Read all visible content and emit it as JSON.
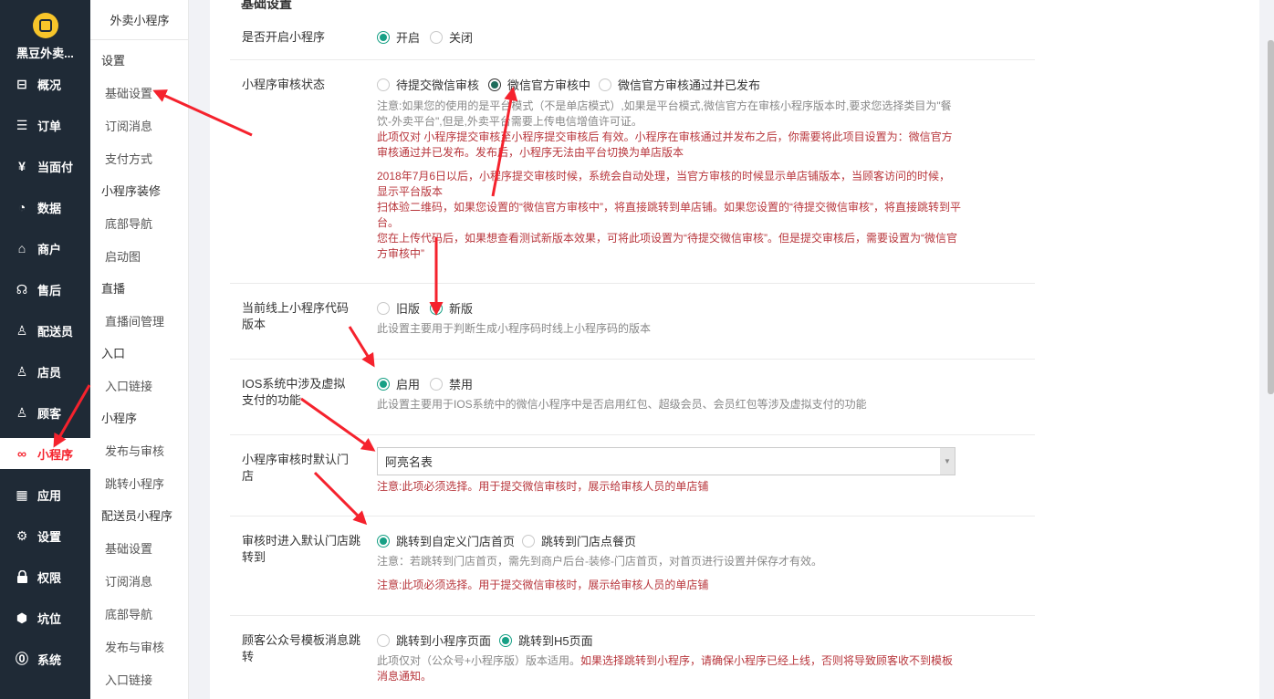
{
  "sidebar": {
    "brand": "黑豆外卖...",
    "items": [
      {
        "label": "概况",
        "icon": "overview-icon",
        "glyph": "⊟"
      },
      {
        "label": "订单",
        "icon": "order-icon",
        "glyph": "☰"
      },
      {
        "label": "当面付",
        "icon": "yen-icon",
        "glyph": "¥"
      },
      {
        "label": "数据",
        "icon": "chart-icon",
        "glyph": "◔"
      },
      {
        "label": "商户",
        "icon": "shop-icon",
        "glyph": "⌂"
      },
      {
        "label": "售后",
        "icon": "service-icon",
        "glyph": "☊"
      },
      {
        "label": "配送员",
        "icon": "courier-icon",
        "glyph": "♙"
      },
      {
        "label": "店员",
        "icon": "clerk-icon",
        "glyph": "♙"
      },
      {
        "label": "顾客",
        "icon": "customer-icon",
        "glyph": "♙"
      },
      {
        "label": "小程序",
        "icon": "miniprogram-icon",
        "glyph": "∞"
      },
      {
        "label": "应用",
        "icon": "apps-icon",
        "glyph": "▦"
      },
      {
        "label": "设置",
        "icon": "gear-icon",
        "glyph": "⚙"
      },
      {
        "label": "权限",
        "icon": "lock-icon",
        "glyph": "🔒"
      },
      {
        "label": "坑位",
        "icon": "cube-icon",
        "glyph": "⬢"
      },
      {
        "label": "系统",
        "icon": "system-icon",
        "glyph": "⓪"
      }
    ]
  },
  "subnav": {
    "title": "外卖小程序",
    "entries": [
      {
        "type": "group",
        "label": "设置"
      },
      {
        "type": "item",
        "label": "基础设置"
      },
      {
        "type": "item",
        "label": "订阅消息"
      },
      {
        "type": "item",
        "label": "支付方式"
      },
      {
        "type": "group",
        "label": "小程序装修"
      },
      {
        "type": "item",
        "label": "底部导航"
      },
      {
        "type": "item",
        "label": "启动图"
      },
      {
        "type": "group",
        "label": "直播"
      },
      {
        "type": "item",
        "label": "直播间管理"
      },
      {
        "type": "group",
        "label": "入口"
      },
      {
        "type": "item",
        "label": "入口链接"
      },
      {
        "type": "group",
        "label": "小程序"
      },
      {
        "type": "item",
        "label": "发布与审核"
      },
      {
        "type": "item",
        "label": "跳转小程序"
      },
      {
        "type": "group",
        "label": "配送员小程序"
      },
      {
        "type": "item",
        "label": "基础设置"
      },
      {
        "type": "item",
        "label": "订阅消息"
      },
      {
        "type": "item",
        "label": "底部导航"
      },
      {
        "type": "item",
        "label": "发布与审核"
      },
      {
        "type": "item",
        "label": "入口链接"
      }
    ]
  },
  "main": {
    "section_title": "基础设置",
    "enable": {
      "label": "是否开启小程序",
      "options": [
        "开启",
        "关闭"
      ]
    },
    "review_status": {
      "label": "小程序审核状态",
      "options": [
        "待提交微信审核",
        "微信官方审核中",
        "微信官方审核通过并已发布"
      ],
      "note_gray": "注意:如果您的使用的是平台模式（不是单店模式）,如果是平台模式,微信官方在审核小程序版本时,要求您选择类目为\"餐饮-外卖平台\",但是,外卖平台需要上传电信增值许可证。",
      "note_red_1": "此项仅对 小程序提交审核至小程序提交审核后 有效。小程序在审核通过并发布之后，你需要将此项目设置为：微信官方审核通过并已发布。发布后，小程序无法由平台切换为单店版本",
      "note_red_2": "2018年7月6日以后，小程序提交审核时候，系统会自动处理，当官方审核的时候显示单店铺版本，当顾客访问的时候，显示平台版本",
      "note_red_3": "扫体验二维码，如果您设置的“微信官方审核中”，将直接跳转到单店铺。如果您设置的“待提交微信审核”，将直接跳转到平台。",
      "note_red_4": "您在上传代码后，如果想查看测试新版本效果，可将此项设置为“待提交微信审核”。但是提交审核后，需要设置为“微信官方审核中”"
    },
    "code_version": {
      "label": "当前线上小程序代码版本",
      "options": [
        "旧版",
        "新版"
      ],
      "note": "此设置主要用于判断生成小程序码时线上小程序码的版本"
    },
    "ios_virtual": {
      "label": "IOS系统中涉及虚拟支付的功能",
      "options": [
        "启用",
        "禁用"
      ],
      "note": "此设置主要用于IOS系统中的微信小程序中是否启用红包、超级会员、会员红包等涉及虚拟支付的功能"
    },
    "default_store": {
      "label": "小程序审核时默认门店",
      "value": "阿亮名表",
      "note": "注意:此项必须选择。用于提交微信审核时，展示给审核人员的单店铺"
    },
    "review_jump": {
      "label": "审核时进入默认门店跳转到",
      "options": [
        "跳转到自定义门店首页",
        "跳转到门店点餐页"
      ],
      "note_gray": "注意：若跳转到门店首页，需先到商户后台-装修-门店首页，对首页进行设置并保存才有效。",
      "note_red": "注意:此项必须选择。用于提交微信审核时，展示给审核人员的单店铺"
    },
    "template_msg": {
      "label": "顾客公众号模板消息跳转",
      "options": [
        "跳转到小程序页面",
        "跳转到H5页面"
      ],
      "note_gray": "此项仅对（公众号+小程序版）版本适用。",
      "note_red": "如果选择跳转到小程序，请确保小程序已经上线，否则将导致顾客收不到模板消息通知。"
    }
  },
  "colors": {
    "accent": "#16a085",
    "warning": "#b8363c",
    "sidebar": "#1f2a36",
    "annotation": "#f5222d"
  }
}
